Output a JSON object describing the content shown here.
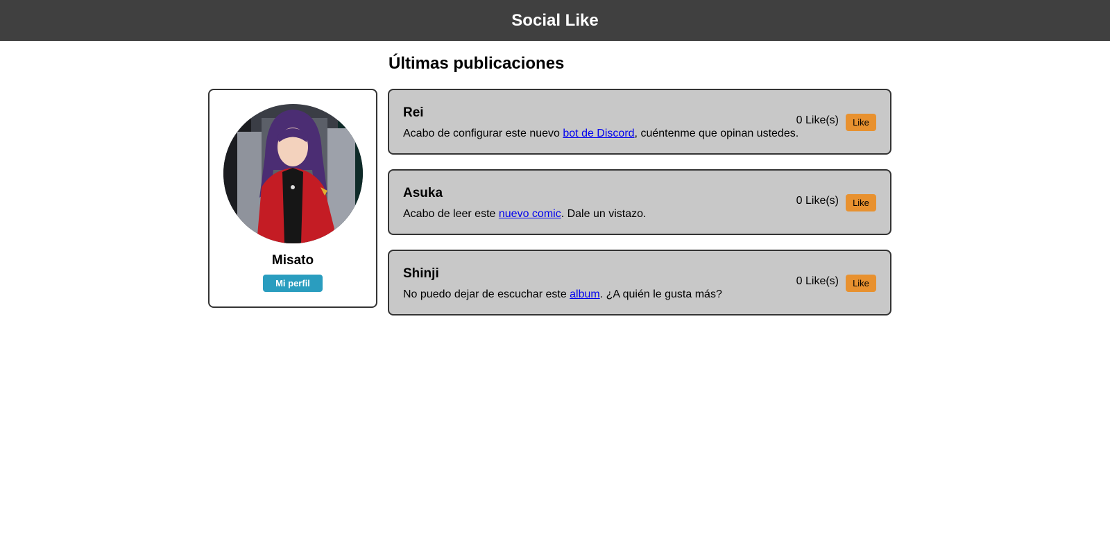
{
  "header": {
    "title": "Social Like"
  },
  "feed": {
    "title": "Últimas publicaciones"
  },
  "profile": {
    "name": "Misato",
    "button_label": "Mi perfil"
  },
  "colors": {
    "header_bg": "#404040",
    "post_bg": "#c8c8c8",
    "like_btn": "#e8912f",
    "profile_btn": "#2a9dbf"
  },
  "posts": [
    {
      "author": "Rei",
      "text_before": "Acabo de configurar este nuevo ",
      "link": "bot de Discord",
      "text_after": ", cuéntenme que opinan ustedes.",
      "likes": "0 Like(s)",
      "like_label": "Like"
    },
    {
      "author": "Asuka",
      "text_before": "Acabo de leer este ",
      "link": "nuevo comic",
      "text_after": ". Dale un vistazo.",
      "likes": "0 Like(s)",
      "like_label": "Like"
    },
    {
      "author": "Shinji",
      "text_before": "No puedo dejar de escuchar este ",
      "link": "album",
      "text_after": ". ¿A quién le gusta más?",
      "likes": "0 Like(s)",
      "like_label": "Like"
    }
  ]
}
